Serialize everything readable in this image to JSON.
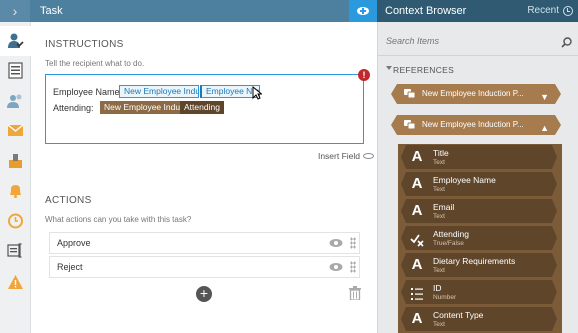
{
  "header": {
    "collapse_icon": "chevron-right-icon",
    "task_title": "Task",
    "toggle_icon": "link-toggle-icon"
  },
  "context_browser": {
    "title": "Context Browser",
    "recent_label": "Recent",
    "search_placeholder": "Search Items",
    "references_title": "REFERENCES",
    "references": [
      {
        "label": "New Employee Induction P...",
        "expanded": false
      },
      {
        "label": "New Employee Induction P...",
        "expanded": true
      }
    ],
    "fields": [
      {
        "name": "Title",
        "type": "Text",
        "icon": "text-icon"
      },
      {
        "name": "Employee Name",
        "type": "Text",
        "icon": "text-icon"
      },
      {
        "name": "Email",
        "type": "Text",
        "icon": "text-icon"
      },
      {
        "name": "Attending",
        "type": "True/False",
        "icon": "boolean-icon"
      },
      {
        "name": "Dietary Requirements",
        "type": "Text",
        "icon": "text-icon"
      },
      {
        "name": "ID",
        "type": "Number",
        "icon": "number-icon"
      },
      {
        "name": "Content Type",
        "type": "Text",
        "icon": "text-icon"
      }
    ]
  },
  "rail": {
    "items": [
      "task-icon",
      "form-icon",
      "users-icon",
      "email-icon",
      "approve-icon",
      "alert-icon",
      "timer-icon",
      "text-icon",
      "warning-icon"
    ]
  },
  "task": {
    "instructions_title": "INSTRUCTIONS",
    "instructions_hint": "Tell the recipient what to do.",
    "line1_label": "Employee Name:",
    "line1_token_a": "New Employee Indu",
    "line1_token_b": "Employee Nam",
    "line2_label": "Attending:",
    "line2_token_a": "New Employee Indu",
    "line2_token_b": "Attending",
    "insert_field_label": "Insert Field",
    "actions_title": "ACTIONS",
    "actions_hint": "What actions can you take with this task?",
    "actions": [
      {
        "label": "Approve"
      },
      {
        "label": "Reject"
      }
    ],
    "add_label": "+"
  },
  "colors": {
    "header": "#4d7f9f",
    "context_header": "#2f5a72",
    "accent_blue": "#2a99dd",
    "reference_brown": "#a67c4f",
    "field_dark_brown": "#5f462b",
    "error_red": "#c0282d"
  }
}
